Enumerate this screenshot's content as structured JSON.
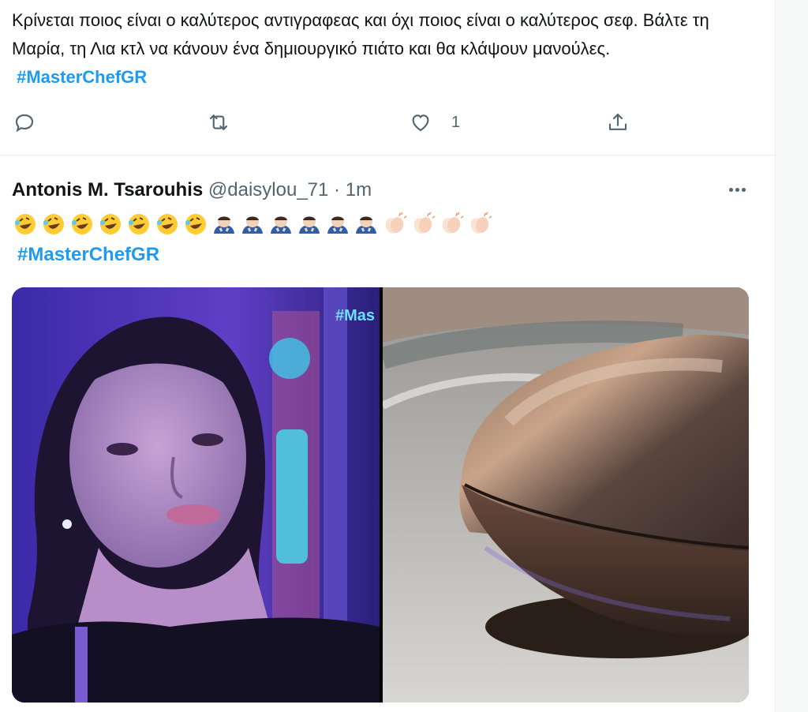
{
  "tweet1": {
    "text": "Κρίνεται ποιος είναι ο καλύτερος αντιγραφεας και όχι ποιος είναι ο καλύτερος σεφ. Βάλτε τη Μαρία, τη Λια κτλ να κάνουν ένα δημιουργικό πιάτο και θα κλάψουν μανούλες.",
    "hashtag": "#MasterChefGR",
    "like_count": "1"
  },
  "tweet2": {
    "author_name": "Antonis M. Tsarouhis",
    "handle": "@daisylou_71",
    "separator": "·",
    "time": "1m",
    "emojis": [
      "rofl",
      "rofl",
      "rofl",
      "rofl",
      "rofl",
      "rofl",
      "rofl",
      "bowing-man",
      "bowing-man",
      "bowing-man",
      "bowing-man",
      "bowing-man",
      "bowing-man",
      "clapping-hands",
      "clapping-hands",
      "clapping-hands",
      "clapping-hands"
    ],
    "hashtag": "#MasterChefGR",
    "media_overlay_text": "#Mas"
  },
  "colors": {
    "accent": "#1d9bf0",
    "secondary_text": "#536471",
    "divider": "#e6ecf0"
  }
}
